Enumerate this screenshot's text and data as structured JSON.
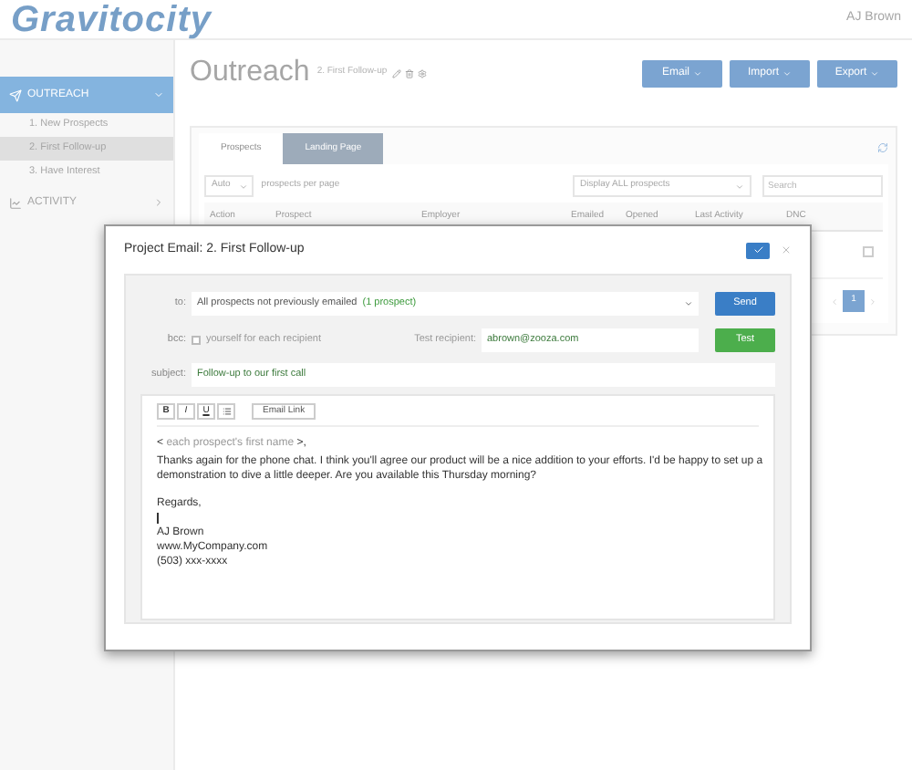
{
  "app": {
    "logo": "Gravitocity",
    "user": "AJ Brown"
  },
  "sidebar": {
    "sections": [
      {
        "label": "OUTREACH",
        "selected": true,
        "expanded": true,
        "children": [
          {
            "label": "1. New Prospects",
            "selected": false
          },
          {
            "label": "2. First Follow-up",
            "selected": true
          },
          {
            "label": "3. Have Interest",
            "selected": false
          }
        ]
      },
      {
        "label": "ACTIVITY",
        "selected": false,
        "expanded": false
      }
    ]
  },
  "page": {
    "title": "Outreach",
    "subtitle": "2. First Follow-up",
    "actions": [
      "Email",
      "Import",
      "Export"
    ],
    "tabs": [
      {
        "label": "Prospects",
        "selected": true
      },
      {
        "label": "Landing Page",
        "selected": false
      }
    ],
    "per_page": "Auto",
    "per_page_label": "prospects per page",
    "filter": "Display ALL prospects",
    "search": {
      "placeholder": "Search"
    },
    "columns": [
      "Action",
      "Prospect",
      "Employer",
      "Emailed",
      "Opened",
      "Last Activity",
      "DNC"
    ],
    "rows": [
      {
        "dnc": false
      }
    ],
    "pages": [
      {
        "label": "1",
        "selected": true
      }
    ]
  },
  "modal": {
    "title": "Project Email: 2. First Follow-up",
    "to_label": "to:",
    "to_value": "All prospects not previously emailed",
    "to_count": "(1 prospect)",
    "send": "Send",
    "bcc_label": "bcc:",
    "bcc_checked": false,
    "bcc_text": "yourself for each recipient",
    "test_label": "Test recipient:",
    "test_value": "abrown@zooza.com",
    "test": "Test",
    "subject_label": "subject:",
    "subject": "Follow-up to our first call",
    "format_buttons": [
      "B",
      "I",
      "U"
    ],
    "email_link": "Email Link",
    "greeting": {
      "prefix": "<",
      "token": "each prospect's first name",
      "suffix": ">,"
    },
    "body": [
      "Thanks again for the phone chat. I think you'll agree our product will be a nice addition to your efforts. I'd be happy to set up a demonstration to dive a little deeper.  Are you available this Thursday morning?"
    ],
    "closing": "Regards,",
    "signature": [
      "AJ Brown",
      "www.MyCompany.com",
      "(503) xxx-xxxx"
    ]
  }
}
